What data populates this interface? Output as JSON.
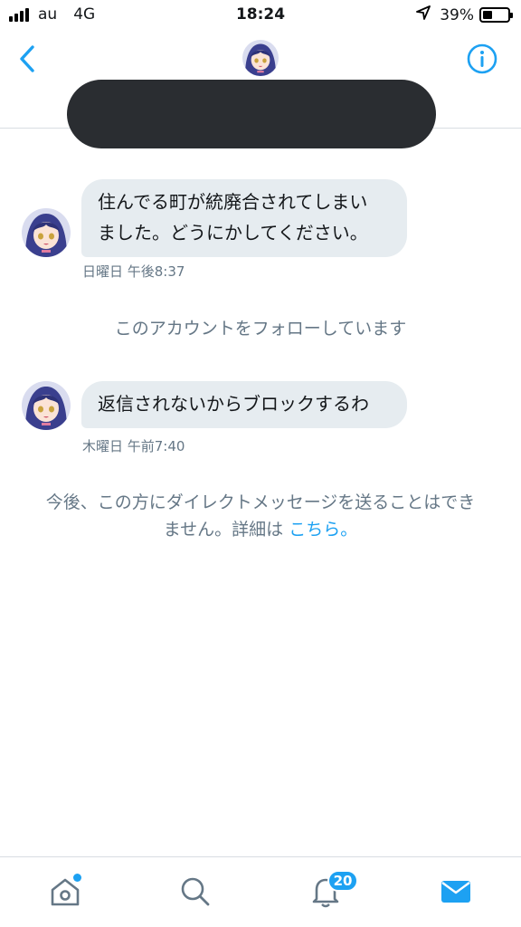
{
  "status_bar": {
    "carrier": "au",
    "network": "4G",
    "time": "18:24",
    "battery": "39%",
    "battery_level": 0.39
  },
  "header": {
    "back_icon": "chevron-left-icon",
    "info_icon": "info-icon",
    "accent_color": "#1da1f2"
  },
  "messages": [
    {
      "lines": [
        "住んでる町が統廃合されてしまい",
        "ました。どうにかしてください。"
      ],
      "time": "日曜日 午後8:37"
    },
    {
      "lines": [
        "返信されないからブロックするわ"
      ],
      "time": "木曜日 午前7:40"
    }
  ],
  "system_note": "このアカウントをフォローしています",
  "dm_notice": {
    "line1": "今後、この方にダイレクトメッセージを送ることはでき",
    "line2": "ません。詳細は ",
    "link": "こちら。"
  },
  "tab_bar": {
    "home_icon": "home-icon",
    "search_icon": "search-icon",
    "notifications_icon": "bell-icon",
    "notifications_badge": "20",
    "messages_icon": "mail-icon"
  }
}
